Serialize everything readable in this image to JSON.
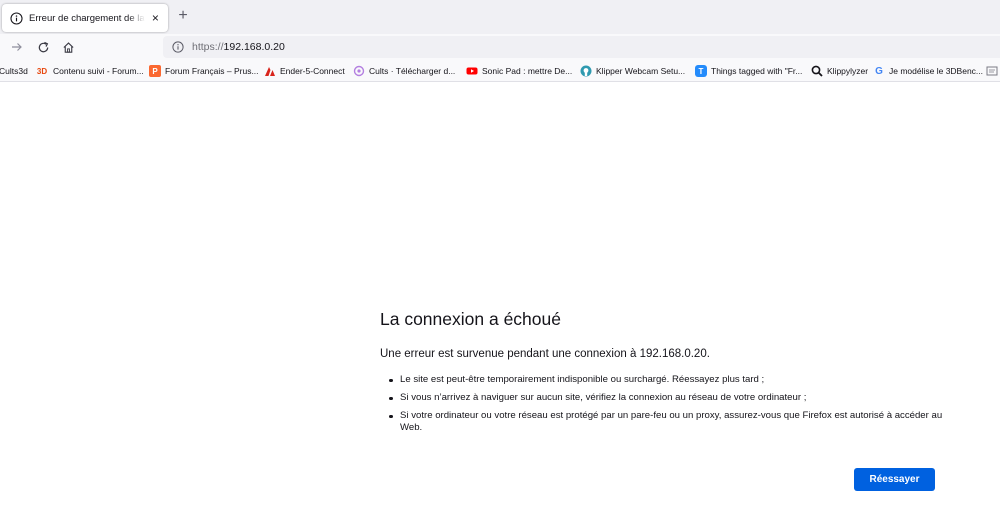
{
  "tab": {
    "title": "Erreur de chargement de la page",
    "close_icon": "×",
    "new_tab_icon": "+"
  },
  "nav": {
    "url_protocol": "https://",
    "url_host": "192.168.0.20"
  },
  "bookmarks": [
    {
      "label": "Cults3d",
      "icon": "cults-icon"
    },
    {
      "label": "Contenu suivi - Forum...",
      "icon": "3d-icon",
      "badge": "3D",
      "color": "#e8470d"
    },
    {
      "label": "Forum Français – Prus...",
      "icon": "prusa-icon",
      "badge": "P",
      "color": "#fa6831"
    },
    {
      "label": "Ender-5-Connect",
      "icon": "creality-icon",
      "color": "#d9241b"
    },
    {
      "label": "Cults  ·  Télécharger d...",
      "icon": "cults-icon",
      "color": "#b37fe0"
    },
    {
      "label": "Sonic Pad : mettre De...",
      "icon": "youtube-icon",
      "color": "#ff0000"
    },
    {
      "label": "Klipper Webcam Setu...",
      "icon": "github-icon",
      "color": "#2f9ab0"
    },
    {
      "label": "Things tagged with \"Fr...",
      "icon": "thingiverse-icon",
      "badge": "T",
      "color": "#248bfb"
    },
    {
      "label": "Klippylyzer",
      "icon": "search-icon"
    },
    {
      "label": "Je modélise le 3DBenc...",
      "icon": "google-icon",
      "badge": "G",
      "color": "#4285f4"
    }
  ],
  "error": {
    "title": "La connexion a échoué",
    "description": "Une erreur est survenue pendant une connexion à 192.168.0.20.",
    "items": [
      "Le site est peut-être temporairement indisponible ou surchargé. Réessayez plus tard ;",
      "Si vous n’arrivez à naviguer sur aucun site, vérifiez la connexion au réseau de votre ordinateur ;",
      "Si votre ordinateur ou votre réseau est protégé par un pare-feu ou un proxy, assurez-vous que Firefox est autorisé à accéder au Web."
    ],
    "retry_label": "Réessayer"
  },
  "colors": {
    "accent": "#0061e0",
    "tabstrip_bg": "#f0f0f4",
    "toolbar_bg": "#f9f9fb"
  }
}
